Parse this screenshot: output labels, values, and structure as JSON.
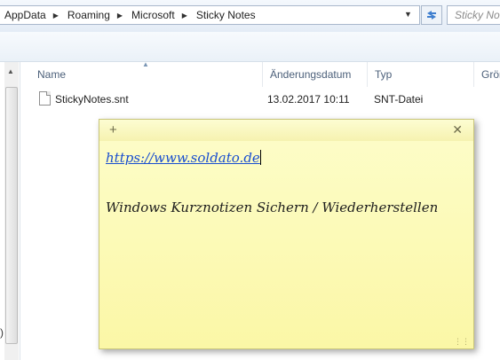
{
  "address": {
    "crumbs": [
      "AppData",
      "Roaming",
      "Microsoft",
      "Sticky Notes"
    ],
    "search_placeholder": "Sticky Notes"
  },
  "icons": {
    "separator": "chevron-right-icon",
    "dropdown": "chevron-down-icon",
    "refresh": "refresh-icon",
    "file": "document-icon",
    "add": "plus-icon",
    "close": "close-icon"
  },
  "columns": [
    "Name",
    "Änderungsdatum",
    "Typ",
    "Größe"
  ],
  "files": [
    {
      "name": "StickyNotes.snt",
      "modified": "13.02.2017 10:11",
      "type": "SNT-Datei",
      "size": ""
    }
  ],
  "note": {
    "link": "https://www.soldato.de",
    "text": "Windows Kurznotizen Sichern / Wiederherstellen",
    "add_label": "+",
    "close_label": "✕",
    "color": "#fbf7a6"
  }
}
